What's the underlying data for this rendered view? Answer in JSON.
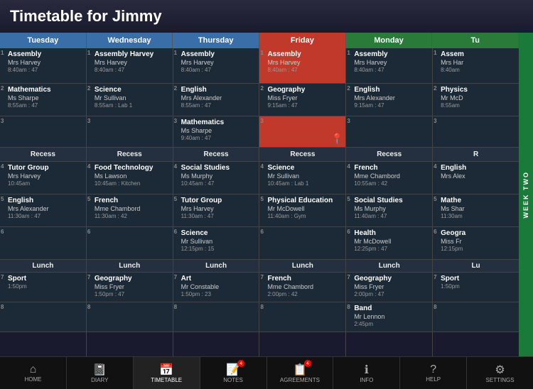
{
  "header": {
    "title": "Timetable for Jimmy"
  },
  "days": [
    "Tuesday",
    "Wednesday",
    "Thursday",
    "Friday",
    "Monday",
    "Tu"
  ],
  "day_classes": [
    "",
    "",
    "",
    "fri",
    "mon-wed",
    "mon-wed"
  ],
  "columns": [
    {
      "day": "Tuesday",
      "cells": [
        {
          "type": "period",
          "num": "1",
          "subject": "Assembly",
          "teacher": "Mrs Harvey",
          "time": "8:40am : 47"
        },
        {
          "type": "period",
          "num": "2",
          "subject": "Mathematics",
          "teacher": "Ms Sharpe",
          "time": "8:55am : 47"
        },
        {
          "type": "empty",
          "num": "3",
          "subject": "",
          "teacher": "",
          "time": ""
        },
        {
          "type": "break",
          "label": "Recess"
        },
        {
          "type": "period",
          "num": "4",
          "subject": "Tutor Group",
          "teacher": "Mrs Harvey",
          "time": "10:45am"
        },
        {
          "type": "period",
          "num": "5",
          "subject": "English",
          "teacher": "Mrs Alexander",
          "time": "11:30am : 47"
        },
        {
          "type": "empty",
          "num": "6",
          "subject": "",
          "teacher": "",
          "time": ""
        },
        {
          "type": "lunch",
          "label": "Lunch"
        },
        {
          "type": "period",
          "num": "7",
          "subject": "Sport",
          "teacher": "",
          "time": "1:50pm"
        },
        {
          "type": "empty",
          "num": "8",
          "subject": "",
          "teacher": "",
          "time": ""
        }
      ]
    },
    {
      "day": "Wednesday",
      "cells": [
        {
          "type": "period",
          "num": "1",
          "subject": "Assembly Harvey",
          "teacher": "Mrs Harvey",
          "time": "8:40am : 47"
        },
        {
          "type": "period",
          "num": "2",
          "subject": "Science",
          "teacher": "Mr Sullivan",
          "time": "8:55am : Lab 1"
        },
        {
          "type": "empty",
          "num": "3",
          "subject": "",
          "teacher": "",
          "time": ""
        },
        {
          "type": "break",
          "label": "Recess"
        },
        {
          "type": "period",
          "num": "4",
          "subject": "Food Technology",
          "teacher": "Ms Lawson",
          "time": "10:45am : Kitchen"
        },
        {
          "type": "period",
          "num": "5",
          "subject": "French",
          "teacher": "Mme Chambord",
          "time": "11:30am : 42"
        },
        {
          "type": "empty",
          "num": "6",
          "subject": "",
          "teacher": "",
          "time": ""
        },
        {
          "type": "lunch",
          "label": "Lunch"
        },
        {
          "type": "period",
          "num": "7",
          "subject": "Geography",
          "teacher": "Miss Fryer",
          "time": "1:50pm : 47"
        },
        {
          "type": "empty",
          "num": "8",
          "subject": "",
          "teacher": "",
          "time": ""
        }
      ]
    },
    {
      "day": "Thursday",
      "cells": [
        {
          "type": "period",
          "num": "1",
          "subject": "Assembly",
          "teacher": "Mrs Harvey",
          "time": "8:40am : 47"
        },
        {
          "type": "period",
          "num": "2",
          "subject": "English",
          "teacher": "Mrs Alexander",
          "time": "8:55am : 47"
        },
        {
          "type": "period",
          "num": "3",
          "subject": "Mathematics",
          "teacher": "Ms Sharpe",
          "time": "9:40am : 47"
        },
        {
          "type": "break",
          "label": "Recess"
        },
        {
          "type": "period",
          "num": "4",
          "subject": "Social Studies",
          "teacher": "Ms Murphy",
          "time": "10:45am : 47"
        },
        {
          "type": "period",
          "num": "5",
          "subject": "Tutor Group",
          "teacher": "Mrs Harvey",
          "time": "11:30am : 47"
        },
        {
          "type": "period",
          "num": "6",
          "subject": "Science",
          "teacher": "Mr Sullivan",
          "time": "12:15pm : 15"
        },
        {
          "type": "lunch",
          "label": "Lunch"
        },
        {
          "type": "period",
          "num": "7",
          "subject": "Art",
          "teacher": "Mr Constable",
          "time": "1:50pm : 23"
        },
        {
          "type": "empty",
          "num": "8",
          "subject": "",
          "teacher": "",
          "time": ""
        }
      ]
    },
    {
      "day": "Friday",
      "cells": [
        {
          "type": "period",
          "num": "1",
          "subject": "Assembly",
          "teacher": "Mrs Harvey",
          "time": "8:40am : 47",
          "highlighted": true
        },
        {
          "type": "period",
          "num": "2",
          "subject": "Geography",
          "teacher": "Miss Fryer",
          "time": "9:15am : 47"
        },
        {
          "type": "empty",
          "num": "3",
          "subject": "",
          "teacher": "",
          "time": "",
          "highlighted": true,
          "haspin": true
        },
        {
          "type": "break",
          "label": "Recess"
        },
        {
          "type": "period",
          "num": "4",
          "subject": "Science",
          "teacher": "Mr Sullivan",
          "time": "10:45am : Lab 1"
        },
        {
          "type": "period",
          "num": "5",
          "subject": "Physical Education",
          "teacher": "Mr McDowell",
          "time": "11:40am : Gym"
        },
        {
          "type": "empty",
          "num": "6",
          "subject": "",
          "teacher": "",
          "time": ""
        },
        {
          "type": "lunch",
          "label": "Lunch"
        },
        {
          "type": "period",
          "num": "7",
          "subject": "French",
          "teacher": "Mme Chambord",
          "time": "2:00pm : 42"
        },
        {
          "type": "empty",
          "num": "8",
          "subject": "",
          "teacher": "",
          "time": ""
        }
      ]
    },
    {
      "day": "Monday",
      "cells": [
        {
          "type": "period",
          "num": "1",
          "subject": "Assembly",
          "teacher": "Mrs Harvey",
          "time": "8:40am : 47"
        },
        {
          "type": "period",
          "num": "2",
          "subject": "English",
          "teacher": "Mrs Alexander",
          "time": "9:15am : 47"
        },
        {
          "type": "empty",
          "num": "3",
          "subject": "",
          "teacher": "",
          "time": ""
        },
        {
          "type": "break",
          "label": "Recess"
        },
        {
          "type": "period",
          "num": "4",
          "subject": "French",
          "teacher": "Mme Chambord",
          "time": "10:55am : 42"
        },
        {
          "type": "period",
          "num": "5",
          "subject": "Social Studies",
          "teacher": "Ms Murphy",
          "time": "11:40am : 47"
        },
        {
          "type": "period",
          "num": "6",
          "subject": "Health",
          "teacher": "Mr McDowell",
          "time": "12:25pm : 47"
        },
        {
          "type": "lunch",
          "label": "Lunch"
        },
        {
          "type": "period",
          "num": "7",
          "subject": "Geography",
          "teacher": "Miss Fryer",
          "time": "2:00pm : 47"
        },
        {
          "type": "period",
          "num": "8",
          "subject": "Band",
          "teacher": "Mr Lennon",
          "time": "2:45pm"
        }
      ]
    },
    {
      "day": "Tu",
      "cells": [
        {
          "type": "period",
          "num": "1",
          "subject": "Assem",
          "teacher": "Mrs Har",
          "time": "8:40am"
        },
        {
          "type": "period",
          "num": "2",
          "subject": "Physics",
          "teacher": "Mr McD",
          "time": "8:55am"
        },
        {
          "type": "empty",
          "num": "3",
          "subject": "",
          "teacher": "",
          "time": ""
        },
        {
          "type": "break",
          "label": "R"
        },
        {
          "type": "period",
          "num": "4",
          "subject": "English",
          "teacher": "Mrs Alex",
          "time": ""
        },
        {
          "type": "period",
          "num": "5",
          "subject": "Mathe",
          "teacher": "Ms Shar",
          "time": "11:30am"
        },
        {
          "type": "period",
          "num": "6",
          "subject": "Geogra",
          "teacher": "Miss Fr",
          "time": "12:15pm"
        },
        {
          "type": "lunch",
          "label": "Lu"
        },
        {
          "type": "period",
          "num": "7",
          "subject": "Sport",
          "teacher": "",
          "time": "1:50pm"
        },
        {
          "type": "empty",
          "num": "8",
          "subject": "",
          "teacher": "",
          "time": ""
        }
      ]
    }
  ],
  "week_label": "WEEK TWO",
  "nav": [
    {
      "label": "HOME",
      "icon": "⌂",
      "active": false
    },
    {
      "label": "DIARY",
      "icon": "📓",
      "active": false
    },
    {
      "label": "TIMETABLE",
      "icon": "📅",
      "active": true
    },
    {
      "label": "NOTES",
      "icon": "📝",
      "active": false,
      "badge": "4"
    },
    {
      "label": "AGREEMENTS",
      "icon": "📋",
      "active": false,
      "badge": "4"
    },
    {
      "label": "INFO",
      "icon": "ℹ",
      "active": false
    },
    {
      "label": "HELP",
      "icon": "?",
      "active": false
    },
    {
      "label": "SETTINGS",
      "icon": "⚙",
      "active": false
    }
  ]
}
